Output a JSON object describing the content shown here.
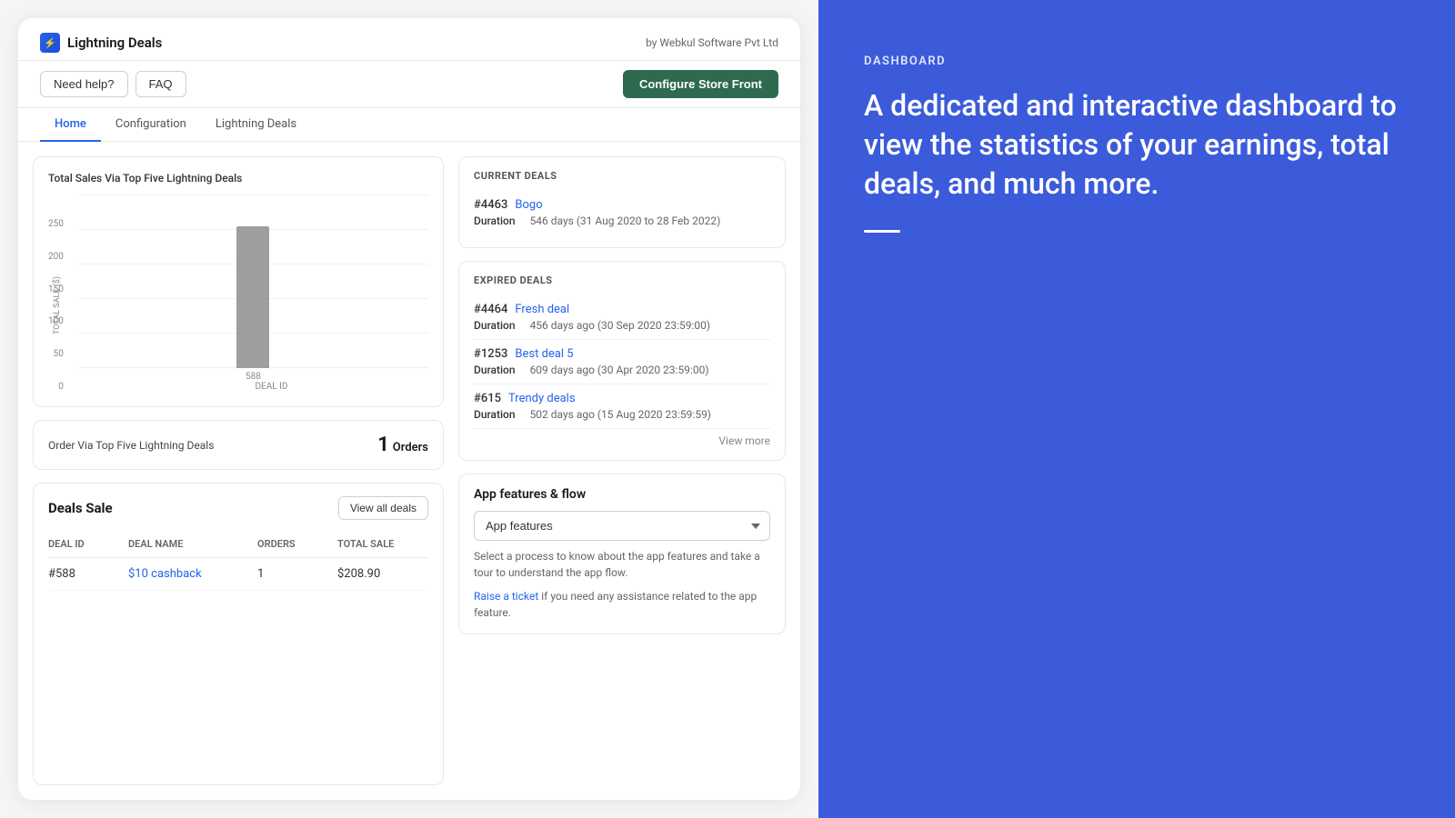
{
  "app": {
    "title": "Lightning Deals",
    "by": "by Webkul Software Pvt Ltd",
    "icon": "⚡"
  },
  "action_bar": {
    "need_help": "Need help?",
    "faq": "FAQ",
    "configure": "Configure Store Front"
  },
  "nav": {
    "tabs": [
      "Home",
      "Configuration",
      "Lightning Deals"
    ],
    "active": "Home"
  },
  "chart": {
    "title": "Total Sales Via Top Five Lightning Deals",
    "y_axis_label": "TOTAL SALE ($)",
    "x_axis_label": "DEAL ID",
    "y_labels": [
      "0",
      "50",
      "100",
      "150",
      "200",
      "250"
    ],
    "x_labels": [
      "588"
    ],
    "bars": [
      {
        "deal_id": "588",
        "height_pct": 82
      }
    ]
  },
  "orders": {
    "label": "Order Via Top Five Lightning Deals",
    "count": "1",
    "unit": "Orders"
  },
  "deals_sale": {
    "title": "Deals Sale",
    "view_all_label": "View all deals",
    "columns": [
      "DEAL ID",
      "DEAL NAME",
      "ORDERS",
      "TOTAL SALE"
    ],
    "rows": [
      {
        "id": "#588",
        "name": "$10 cashback",
        "orders": "1",
        "total": "$208.90"
      }
    ]
  },
  "current_deals": {
    "section_title": "CURRENT DEALS",
    "deals": [
      {
        "id": "#4463",
        "name": "Bogo",
        "duration_label": "Duration",
        "duration_value": "546 days (31 Aug 2020 to 28 Feb 2022)"
      }
    ]
  },
  "expired_deals": {
    "section_title": "EXPIRED DEALS",
    "deals": [
      {
        "id": "#4464",
        "name": "Fresh deal",
        "duration_label": "Duration",
        "duration_value": "456 days ago (30 Sep 2020 23:59:00)"
      },
      {
        "id": "#1253",
        "name": "Best deal 5",
        "duration_label": "Duration",
        "duration_value": "609 days ago (30 Apr 2020 23:59:00)"
      },
      {
        "id": "#615",
        "name": "Trendy deals",
        "duration_label": "Duration",
        "duration_value": "502 days ago (15 Aug 2020 23:59:59)"
      }
    ],
    "view_more": "View more"
  },
  "app_features": {
    "title": "App features & flow",
    "dropdown_default": "App features",
    "description": "Select a process to know about the app features and take a tour to understand the app flow.",
    "ticket_text": "Raise a ticket if you need any assistance related to the app feature.",
    "ticket_link": "Raise a ticket"
  },
  "right_panel": {
    "label": "DASHBOARD",
    "heading": "A dedicated and interactive dashboard to view the statistics of your earnings, total deals, and much more."
  }
}
